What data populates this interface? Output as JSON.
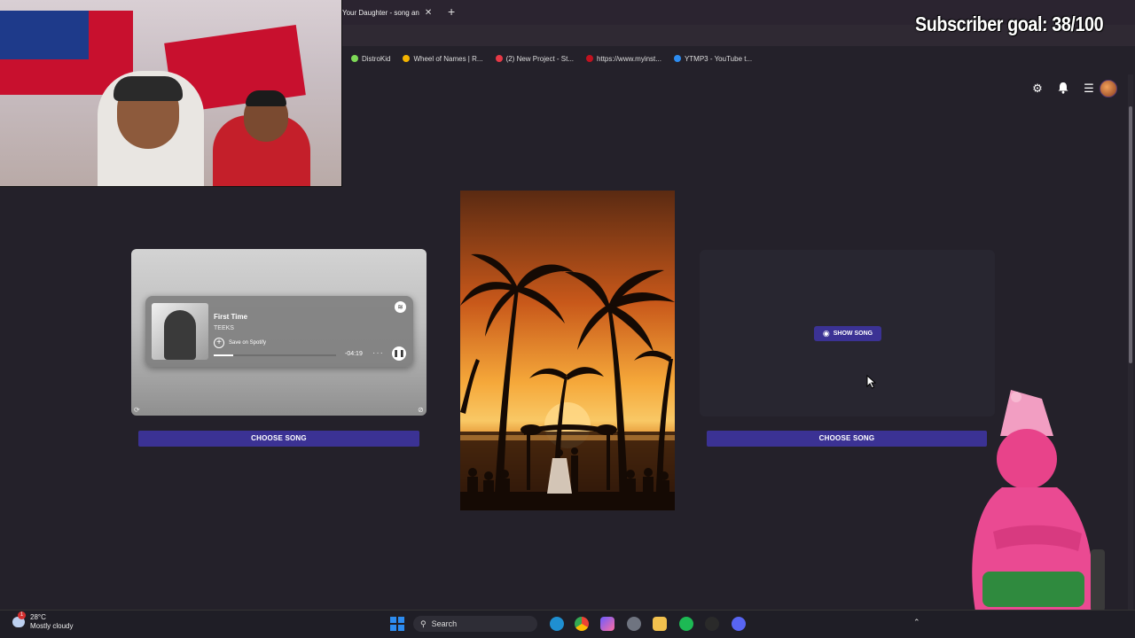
{
  "overlay": {
    "subscriber_goal": "Subscriber goal: 38/100"
  },
  "browser": {
    "tab_title": "Your Daughter - song an",
    "tab_close": "✕",
    "new_tab": "+",
    "bookmarks": [
      {
        "label": "DistroKid",
        "color": "#7ed957"
      },
      {
        "label": "Wheel of Names | R...",
        "color": "#f4b400"
      },
      {
        "label": "(2) New Project - St...",
        "color": "#e63946"
      },
      {
        "label": "https://www.myinst...",
        "color": "#c1121f"
      },
      {
        "label": "YTMP3 - YouTube t...",
        "color": "#2d8cf0"
      }
    ]
  },
  "header": {
    "settings_icon": "gear-icon",
    "notifications_icon": "bell-icon",
    "menu_icon": "menu-icon"
  },
  "left_card": {
    "song_title": "First Time",
    "artist": "TEEKS",
    "save_label": "Save on Spotify",
    "time_remaining": "-04:19",
    "progress": 0.16,
    "choose_label": "CHOOSE SONG"
  },
  "right_card": {
    "show_song_label": "SHOW SONG",
    "choose_label": "CHOOSE SONG"
  },
  "taskbar": {
    "temperature": "28°C",
    "weather": "Mostly cloudy",
    "weather_badge": "1",
    "search_placeholder": "Search"
  },
  "colors": {
    "accent": "#3b3294",
    "background": "#24212a"
  }
}
